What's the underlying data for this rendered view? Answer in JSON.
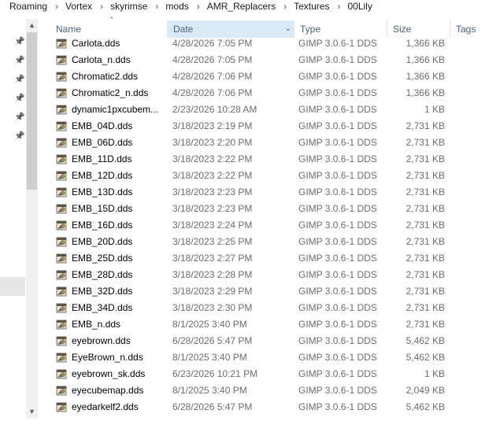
{
  "breadcrumb": [
    "Roaming",
    "Vortex",
    "skyrimse",
    "mods",
    "AMR_Replacers",
    "Textures",
    "00Lily"
  ],
  "icons": {
    "pin": "pin-icon",
    "file": "gimp-file-icon",
    "sort": "sort-ascending-icon",
    "dropdown": "chevron-down-icon",
    "scroll_up": "scroll-up-arrow-icon",
    "scroll_down": "scroll-down-arrow-icon"
  },
  "columns": {
    "name": "Name",
    "date": "Date",
    "type": "Type",
    "size": "Size",
    "tags": "Tags"
  },
  "files": [
    {
      "name": "Carlota.dds",
      "date": "4/28/2026 7:05 PM",
      "type": "GIMP 3.0.6-1 DDS",
      "size": "1,366 KB"
    },
    {
      "name": "Carlota_n.dds",
      "date": "4/28/2026 7:05 PM",
      "type": "GIMP 3.0.6-1 DDS",
      "size": "1,366 KB"
    },
    {
      "name": "Chromatic2.dds",
      "date": "4/28/2026 7:06 PM",
      "type": "GIMP 3.0.6-1 DDS",
      "size": "1,366 KB"
    },
    {
      "name": "Chromatic2_n.dds",
      "date": "4/28/2026 7:06 PM",
      "type": "GIMP 3.0.6-1 DDS",
      "size": "1,366 KB"
    },
    {
      "name": "dynamic1pxcubem...",
      "date": "2/23/2026 10:28 AM",
      "type": "GIMP 3.0.6-1 DDS",
      "size": "1 KB"
    },
    {
      "name": "EMB_04D.dds",
      "date": "3/18/2023 2:19 PM",
      "type": "GIMP 3.0.6-1 DDS",
      "size": "2,731 KB"
    },
    {
      "name": "EMB_06D.dds",
      "date": "3/18/2023 2:20 PM",
      "type": "GIMP 3.0.6-1 DDS",
      "size": "2,731 KB"
    },
    {
      "name": "EMB_11D.dds",
      "date": "3/18/2023 2:22 PM",
      "type": "GIMP 3.0.6-1 DDS",
      "size": "2,731 KB"
    },
    {
      "name": "EMB_12D.dds",
      "date": "3/18/2023 2:22 PM",
      "type": "GIMP 3.0.6-1 DDS",
      "size": "2,731 KB"
    },
    {
      "name": "EMB_13D.dds",
      "date": "3/18/2023 2:23 PM",
      "type": "GIMP 3.0.6-1 DDS",
      "size": "2,731 KB"
    },
    {
      "name": "EMB_15D.dds",
      "date": "3/18/2023 2:23 PM",
      "type": "GIMP 3.0.6-1 DDS",
      "size": "2,731 KB"
    },
    {
      "name": "EMB_16D.dds",
      "date": "3/18/2023 2:24 PM",
      "type": "GIMP 3.0.6-1 DDS",
      "size": "2,731 KB"
    },
    {
      "name": "EMB_20D.dds",
      "date": "3/18/2023 2:25 PM",
      "type": "GIMP 3.0.6-1 DDS",
      "size": "2,731 KB"
    },
    {
      "name": "EMB_25D.dds",
      "date": "3/18/2023 2:27 PM",
      "type": "GIMP 3.0.6-1 DDS",
      "size": "2,731 KB"
    },
    {
      "name": "EMB_28D.dds",
      "date": "3/18/2023 2:28 PM",
      "type": "GIMP 3.0.6-1 DDS",
      "size": "2,731 KB"
    },
    {
      "name": "EMB_32D.dds",
      "date": "3/18/2023 2:29 PM",
      "type": "GIMP 3.0.6-1 DDS",
      "size": "2,731 KB"
    },
    {
      "name": "EMB_34D.dds",
      "date": "3/18/2023 2:30 PM",
      "type": "GIMP 3.0.6-1 DDS",
      "size": "2,731 KB"
    },
    {
      "name": "EMB_n.dds",
      "date": "8/1/2025 3:40 PM",
      "type": "GIMP 3.0.6-1 DDS",
      "size": "2,731 KB"
    },
    {
      "name": "eyebrown.dds",
      "date": "6/28/2026 5:47 PM",
      "type": "GIMP 3.0.6-1 DDS",
      "size": "5,462 KB"
    },
    {
      "name": "EyeBrown_n.dds",
      "date": "8/1/2025 3:40 PM",
      "type": "GIMP 3.0.6-1 DDS",
      "size": "5,462 KB"
    },
    {
      "name": "eyebrown_sk.dds",
      "date": "6/23/2026 10:21 PM",
      "type": "GIMP 3.0.6-1 DDS",
      "size": "1 KB"
    },
    {
      "name": "eyecubemap.dds",
      "date": "8/1/2025 3:40 PM",
      "type": "GIMP 3.0.6-1 DDS",
      "size": "2,049 KB"
    },
    {
      "name": "eyedarkelf2.dds",
      "date": "6/28/2026 5:47 PM",
      "type": "GIMP 3.0.6-1 DDS",
      "size": "5,462 KB"
    }
  ]
}
